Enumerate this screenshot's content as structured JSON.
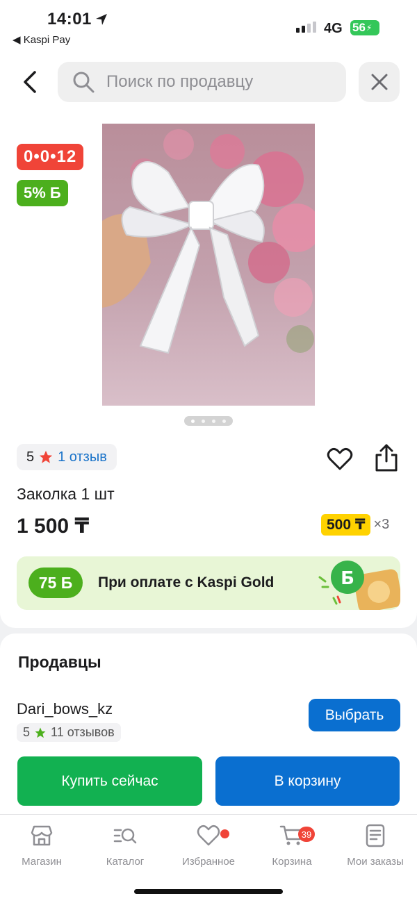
{
  "status_bar": {
    "time": "14:01",
    "back_app": "◀ Kaspi Pay",
    "network": "4G",
    "battery": "56"
  },
  "search": {
    "placeholder": "Поиск по продавцу"
  },
  "product": {
    "timer_badge": "0•0•12",
    "bonus_badge": "5% Б",
    "rating_score": "5",
    "reviews_link": "1 отзыв",
    "title": "Заколка 1 шт",
    "price": "1 500 ₸",
    "installment_amount": "500 ₸",
    "installment_multiplier": "×3",
    "gallery": {
      "count": 4,
      "active_index": 0
    }
  },
  "kaspi_gold": {
    "bonus": "75 Б",
    "text": "При оплате с Kaspi Gold"
  },
  "sellers": {
    "title": "Продавцы",
    "items": [
      {
        "name": "Dari_bows_kz",
        "rating": "5",
        "reviews": "11 отзывов",
        "select_label": "Выбрать"
      }
    ]
  },
  "actions": {
    "buy_now": "Купить сейчас",
    "add_to_cart": "В корзину"
  },
  "tabbar": {
    "items": [
      {
        "label": "Магазин",
        "icon": "store-icon"
      },
      {
        "label": "Каталог",
        "icon": "catalog-icon"
      },
      {
        "label": "Избранное",
        "icon": "heart-icon",
        "dot": true
      },
      {
        "label": "Корзина",
        "icon": "cart-icon",
        "badge": "39"
      },
      {
        "label": "Мои заказы",
        "icon": "orders-icon"
      }
    ]
  },
  "colors": {
    "accent_blue": "#0a6fd0",
    "buy_green": "#12b151",
    "bonus_green": "#4caf1d",
    "timer_red": "#f04438",
    "installment_yellow": "#ffd200"
  }
}
